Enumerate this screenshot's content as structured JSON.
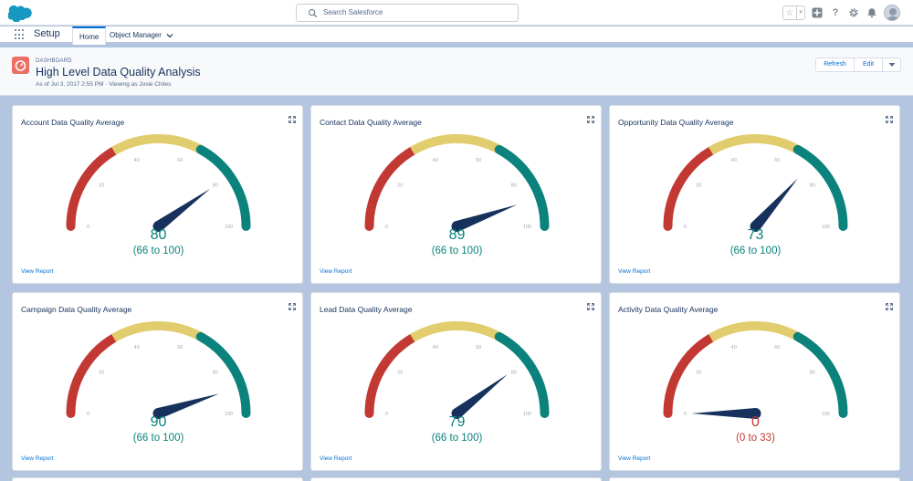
{
  "header": {
    "search_placeholder": "Search Salesforce",
    "icons": [
      "favorites-star-icon",
      "add-icon",
      "help-icon",
      "setup-gear-icon",
      "notifications-bell-icon",
      "user-avatar"
    ]
  },
  "nav": {
    "app_name": "Setup",
    "tabs": [
      {
        "label": "Home",
        "active": true
      },
      {
        "label": "Object Manager",
        "active": false
      }
    ]
  },
  "dashboard": {
    "eyebrow": "DASHBOARD",
    "title": "High Level Data Quality Analysis",
    "subtitle": "As of Jul 3, 2017 2:55 PM · Viewing as Josie Chiles",
    "buttons": {
      "refresh": "Refresh",
      "edit": "Edit"
    }
  },
  "colors": {
    "low": "#c23934",
    "mid": "#e2cd6e",
    "high": "#0b827c",
    "needle": "#16325c",
    "accent": "#0070d2"
  },
  "ticks": [
    "0",
    "20",
    "40",
    "60",
    "80",
    "100"
  ],
  "cards": [
    {
      "title": "Account Data Quality Average",
      "value": "80",
      "range": "(66 to 100)",
      "numeric": 80,
      "status": "high",
      "link": "View Report"
    },
    {
      "title": "Contact Data Quality Average",
      "value": "89",
      "range": "(66 to 100)",
      "numeric": 89,
      "status": "high",
      "link": "View Report"
    },
    {
      "title": "Opportunity Data Quality Average",
      "value": "73",
      "range": "(66 to 100)",
      "numeric": 73,
      "status": "high",
      "link": "View Report"
    },
    {
      "title": "Campaign Data Quality Average",
      "value": "90",
      "range": "(66 to 100)",
      "numeric": 90,
      "status": "high",
      "link": "View Report"
    },
    {
      "title": "Lead Data Quality Average",
      "value": "79",
      "range": "(66 to 100)",
      "numeric": 79,
      "status": "high",
      "link": "View Report"
    },
    {
      "title": "Activity Data Quality Average",
      "value": "0",
      "range": "(0 to 33)",
      "numeric": 0,
      "status": "low",
      "link": "View Report"
    }
  ],
  "chart_data": [
    {
      "type": "gauge",
      "title": "Account Data Quality Average",
      "value": 80,
      "range": [
        0,
        100
      ],
      "bands": [
        {
          "from": 0,
          "to": 33,
          "color": "#c23934"
        },
        {
          "from": 33,
          "to": 66,
          "color": "#e2cd6e"
        },
        {
          "from": 66,
          "to": 100,
          "color": "#0b827c"
        }
      ]
    },
    {
      "type": "gauge",
      "title": "Contact Data Quality Average",
      "value": 89,
      "range": [
        0,
        100
      ],
      "bands": [
        {
          "from": 0,
          "to": 33,
          "color": "#c23934"
        },
        {
          "from": 33,
          "to": 66,
          "color": "#e2cd6e"
        },
        {
          "from": 66,
          "to": 100,
          "color": "#0b827c"
        }
      ]
    },
    {
      "type": "gauge",
      "title": "Opportunity Data Quality Average",
      "value": 73,
      "range": [
        0,
        100
      ],
      "bands": [
        {
          "from": 0,
          "to": 33,
          "color": "#c23934"
        },
        {
          "from": 33,
          "to": 66,
          "color": "#e2cd6e"
        },
        {
          "from": 66,
          "to": 100,
          "color": "#0b827c"
        }
      ]
    },
    {
      "type": "gauge",
      "title": "Campaign Data Quality Average",
      "value": 90,
      "range": [
        0,
        100
      ],
      "bands": [
        {
          "from": 0,
          "to": 33,
          "color": "#c23934"
        },
        {
          "from": 33,
          "to": 66,
          "color": "#e2cd6e"
        },
        {
          "from": 66,
          "to": 100,
          "color": "#0b827c"
        }
      ]
    },
    {
      "type": "gauge",
      "title": "Lead Data Quality Average",
      "value": 79,
      "range": [
        0,
        100
      ],
      "bands": [
        {
          "from": 0,
          "to": 33,
          "color": "#c23934"
        },
        {
          "from": 33,
          "to": 66,
          "color": "#e2cd6e"
        },
        {
          "from": 66,
          "to": 100,
          "color": "#0b827c"
        }
      ]
    },
    {
      "type": "gauge",
      "title": "Activity Data Quality Average",
      "value": 0,
      "range": [
        0,
        100
      ],
      "bands": [
        {
          "from": 0,
          "to": 33,
          "color": "#c23934"
        },
        {
          "from": 33,
          "to": 66,
          "color": "#e2cd6e"
        },
        {
          "from": 66,
          "to": 100,
          "color": "#0b827c"
        }
      ]
    }
  ]
}
